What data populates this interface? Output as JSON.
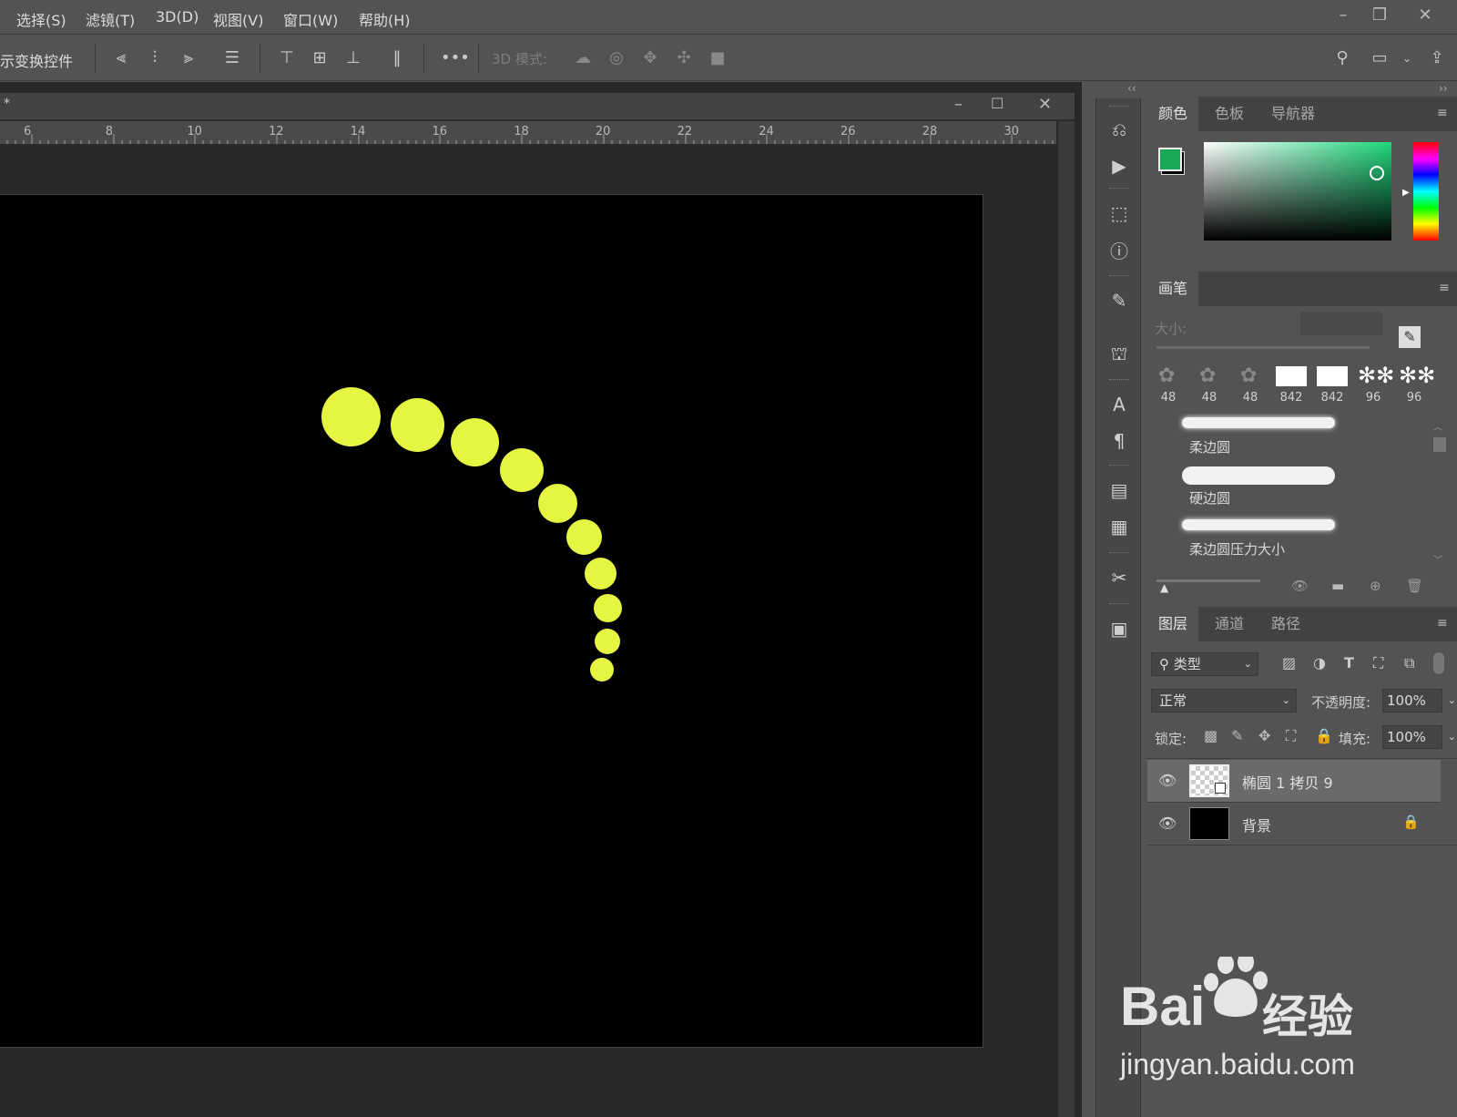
{
  "menu": [
    "选择(S)",
    "滤镜(T)",
    "3D(D)",
    "视图(V)",
    "窗口(W)",
    "帮助(H)"
  ],
  "window_controls": [
    "minimize-icon",
    "restore-icon",
    "close-icon"
  ],
  "options_bar": {
    "transform_label": "示变换控件",
    "mode_label": "3D 模式:"
  },
  "document": {
    "tab_title": "*",
    "ruler_ticks": [
      "6",
      "8",
      "10",
      "12",
      "14",
      "16",
      "18",
      "20",
      "22",
      "24",
      "26",
      "28",
      "30"
    ],
    "dot_color": "#e6f542"
  },
  "color_panel": {
    "tabs": [
      "颜色",
      "色板",
      "导航器"
    ],
    "foreground": "#1aa858",
    "background": "#000000"
  },
  "brush_panel": {
    "tab": "画笔",
    "size_label": "大小:",
    "presets": [
      "48",
      "48",
      "48",
      "842",
      "842",
      "96",
      "96"
    ],
    "brushes": [
      "柔边圆",
      "硬边圆",
      "柔边圆压力大小"
    ]
  },
  "layers_panel": {
    "tabs": [
      "图层",
      "通道",
      "路径"
    ],
    "filter_label": "类型",
    "blend_mode": "正常",
    "opacity_label": "不透明度:",
    "opacity_value": "100%",
    "lock_label": "锁定:",
    "fill_label": "填充:",
    "fill_value": "100%",
    "layers": [
      {
        "name": "椭圆 1 拷贝 9",
        "selected": true
      },
      {
        "name": "背景",
        "locked": true
      }
    ]
  },
  "watermark": {
    "brand_text": "Bai",
    "brand_cn": "经验",
    "url": "jingyan.baidu.com"
  }
}
